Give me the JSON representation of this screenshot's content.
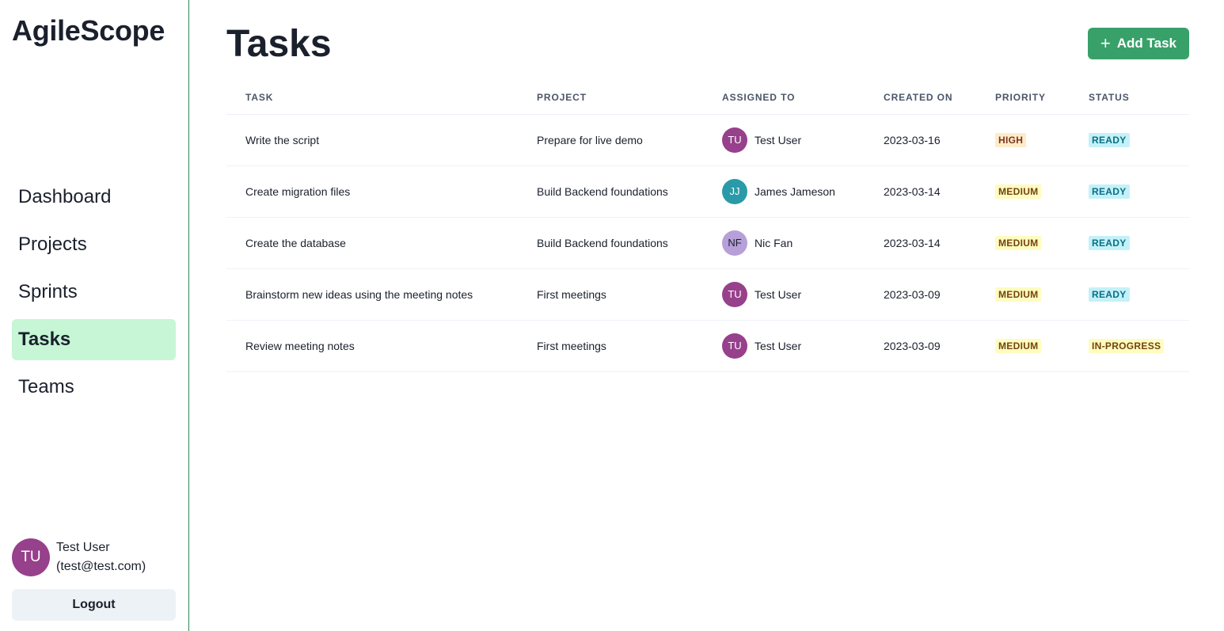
{
  "app": {
    "brand": "AgileScope"
  },
  "sidebar": {
    "items": [
      {
        "label": "Dashboard",
        "active": false
      },
      {
        "label": "Projects",
        "active": false
      },
      {
        "label": "Sprints",
        "active": false
      },
      {
        "label": "Tasks",
        "active": true
      },
      {
        "label": "Teams",
        "active": false
      }
    ],
    "user": {
      "initials": "TU",
      "name": "Test User",
      "email": "(test@test.com)",
      "avatar_color": "#97408b"
    },
    "logout_label": "Logout"
  },
  "page": {
    "title": "Tasks",
    "add_button_label": "Add Task",
    "add_button_icon": "plus-icon"
  },
  "table": {
    "headers": [
      "TASK",
      "PROJECT",
      "ASSIGNED TO",
      "CREATED ON",
      "PRIORITY",
      "STATUS"
    ],
    "rows": [
      {
        "task": "Write the script",
        "project": "Prepare for live demo",
        "assignee": "Test User",
        "initials": "TU",
        "avatar_color": "#97408b",
        "initials_color": "#ffffff",
        "created": "2023-03-16",
        "priority": "HIGH",
        "status": "READY"
      },
      {
        "task": "Create migration files",
        "project": "Build Backend foundations",
        "assignee": "James Jameson",
        "initials": "JJ",
        "avatar_color": "#2b9aa8",
        "initials_color": "#ffffff",
        "created": "2023-03-14",
        "priority": "MEDIUM",
        "status": "READY"
      },
      {
        "task": "Create the database",
        "project": "Build Backend foundations",
        "assignee": "Nic Fan",
        "initials": "NF",
        "avatar_color": "#b79fd8",
        "initials_color": "#1a202c",
        "created": "2023-03-14",
        "priority": "MEDIUM",
        "status": "READY"
      },
      {
        "task": "Brainstorm new ideas using the meeting notes",
        "project": "First meetings",
        "assignee": "Test User",
        "initials": "TU",
        "avatar_color": "#97408b",
        "initials_color": "#ffffff",
        "created": "2023-03-09",
        "priority": "MEDIUM",
        "status": "READY"
      },
      {
        "task": "Review meeting notes",
        "project": "First meetings",
        "assignee": "Test User",
        "initials": "TU",
        "avatar_color": "#97408b",
        "initials_color": "#ffffff",
        "created": "2023-03-09",
        "priority": "MEDIUM",
        "status": "IN-PROGRESS"
      }
    ]
  },
  "badge_colors": {
    "HIGH": {
      "bg": "#feebc8",
      "fg": "#7b341e"
    },
    "MEDIUM": {
      "bg": "#fefcbf",
      "fg": "#744210"
    },
    "READY": {
      "bg": "#c4f1f9",
      "fg": "#086f83"
    },
    "IN-PROGRESS": {
      "bg": "#fefcbf",
      "fg": "#744210"
    }
  },
  "colors": {
    "accent": "#38a169",
    "active_nav_bg": "#c6f6d5",
    "sidebar_border": "#2f855a"
  }
}
